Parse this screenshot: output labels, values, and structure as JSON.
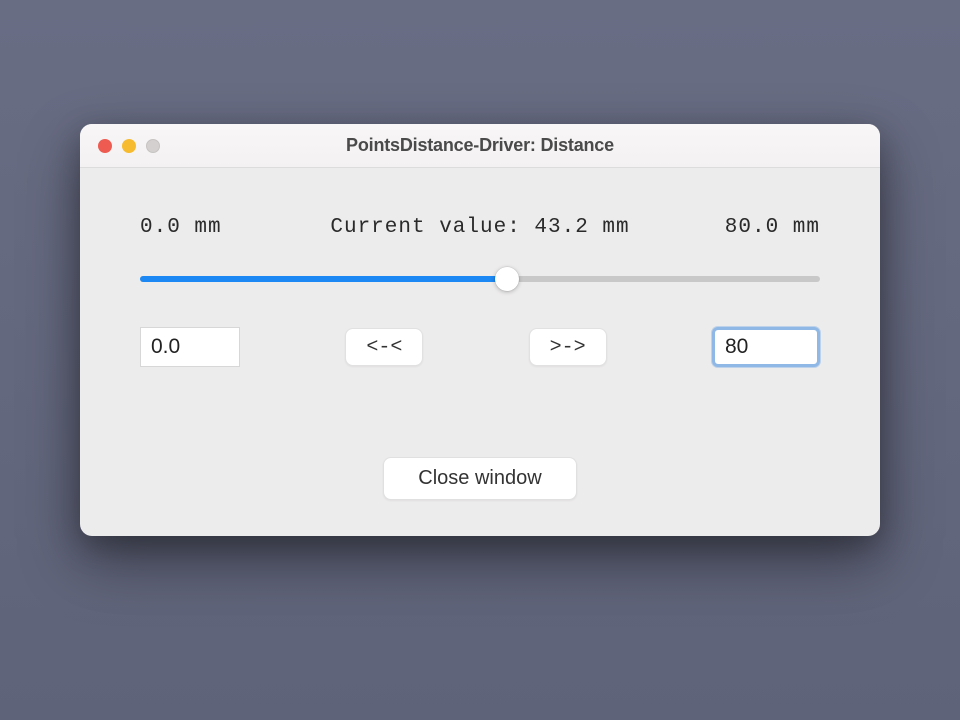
{
  "window": {
    "title": "PointsDistance-Driver: Distance"
  },
  "slider": {
    "min_label": "0.0 mm",
    "current_label": "Current value: 43.2 mm",
    "max_label": "80.0 mm",
    "min_value": 0.0,
    "max_value": 80.0,
    "current_value": 43.2,
    "fill_percent": 54
  },
  "inputs": {
    "min_field": "0.0",
    "max_field": "80"
  },
  "buttons": {
    "step_left": "<-<",
    "step_right": ">->",
    "close": "Close window"
  }
}
